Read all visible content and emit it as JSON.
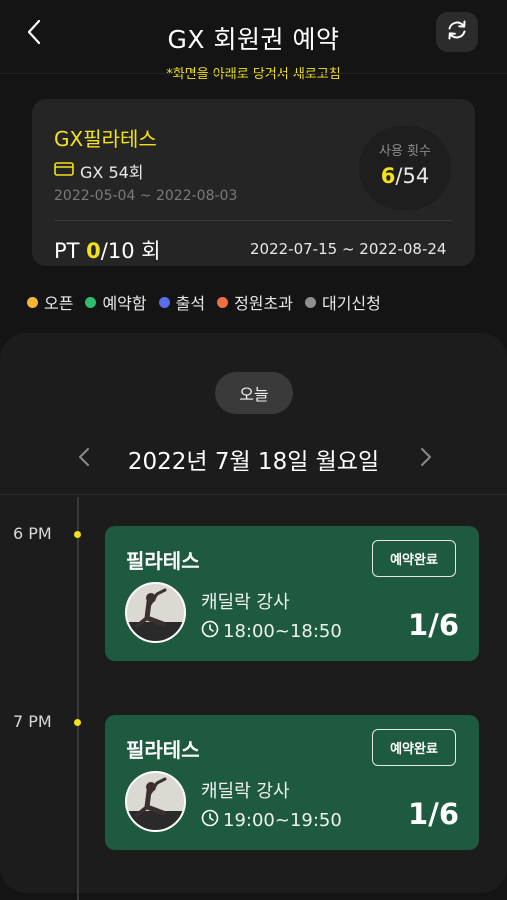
{
  "header": {
    "title": "GX 회원권 예약",
    "subtitle": "*화면을 아래로 당겨서 새로고침",
    "back_icon": "chevron-left-icon",
    "refresh_icon": "refresh-icon"
  },
  "membership": {
    "program": "GX필라테스",
    "pass_label": "GX 54회",
    "pass_icon": "card-icon",
    "period": "2022-05-04 ~ 2022-08-03",
    "usage_label": "사용 횟수",
    "usage_used": "6",
    "usage_total": "/54",
    "pt_prefix": "PT ",
    "pt_used": "0",
    "pt_suffix": "/10 회",
    "pt_period": "2022-07-15 ~ 2022-08-24"
  },
  "legend": [
    {
      "label": "오픈",
      "color": "#f5b731"
    },
    {
      "label": "예약함",
      "color": "#2ebd6f"
    },
    {
      "label": "출석",
      "color": "#5b6cf0"
    },
    {
      "label": "정원초과",
      "color": "#ee6f43"
    },
    {
      "label": "대기신청",
      "color": "#8f8f8f"
    }
  ],
  "schedule": {
    "today_label": "오늘",
    "date": "2022년 7월 18일 월요일",
    "slots": [
      {
        "time_label": "6 PM",
        "lesson": {
          "name": "필라테스",
          "status": "예약완료",
          "teacher": "캐딜락 강사",
          "time": "18:00~18:50",
          "count": "1/6"
        }
      },
      {
        "time_label": "7 PM",
        "lesson": {
          "name": "필라테스",
          "status": "예약완료",
          "teacher": "캐딜락 강사",
          "time": "19:00~19:50",
          "count": "1/6"
        }
      }
    ]
  },
  "colors": {
    "accent": "#f2e21c",
    "lesson_card": "#1d5a3f",
    "background": "#141414"
  }
}
